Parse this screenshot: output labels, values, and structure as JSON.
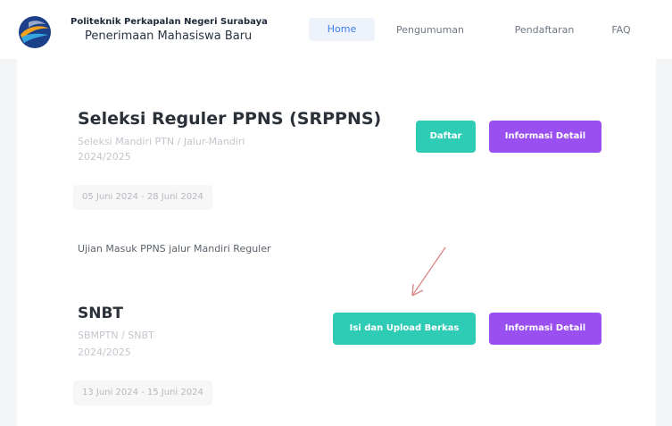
{
  "header": {
    "brand_line1": "Politeknik Perkapalan Negeri Surabaya",
    "brand_line2": "Penerimaan Mahasiswa Baru",
    "nav": [
      {
        "label": "Home"
      },
      {
        "label": "Pengumuman"
      },
      {
        "label": "Pendaftaran"
      },
      {
        "label": "FAQ"
      }
    ]
  },
  "cards": [
    {
      "title": "Seleksi Reguler PPNS (SRPPNS)",
      "subtitle_line1": "Seleksi Mandiri PTN / Jalur-Mandiri",
      "subtitle_line2": "2024/2025",
      "date_range": "05 Juni 2024 - 28 Juni 2024",
      "description": "Ujian Masuk PPNS jalur Mandiri Reguler",
      "primary_button": "Daftar",
      "secondary_button": "Informasi Detail"
    },
    {
      "title": "SNBT",
      "subtitle_line1": "SBMPTN / SNBT",
      "subtitle_line2": "2024/2025",
      "date_range": "13 Juni 2024 - 15 Juni 2024",
      "primary_button": "Isi dan Upload Berkas",
      "secondary_button": "Informasi Detail"
    }
  ],
  "colors": {
    "teal": "#2ecbb5",
    "purple": "#9a4ff0",
    "nav_active": "#3d7df0",
    "arrow": "#d98a8a"
  },
  "icons": {
    "logo": "ppns-logo",
    "annotation": "annotation-arrow"
  }
}
